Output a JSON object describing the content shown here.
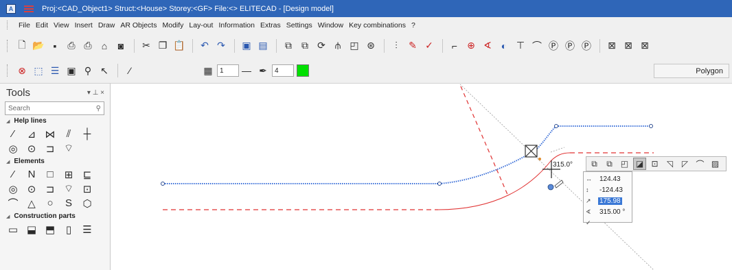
{
  "window": {
    "app_icon": "A",
    "title": "Proj:<CAD_Object1> Struct:<House> Storey:<GF> File:<> ELITECAD - [Design model]"
  },
  "menu": [
    "File",
    "Edit",
    "View",
    "Insert",
    "Draw",
    "AR Objects",
    "Modify",
    "Lay-out",
    "Information",
    "Extras",
    "Settings",
    "Window",
    "Key combinations",
    "?"
  ],
  "toolbar1_icons": [
    "new-file-icon",
    "open-file-icon",
    "save-icon",
    "print-icon",
    "print-preview-icon",
    "plot-icon",
    "export-icon",
    "cut-icon",
    "copy-icon",
    "paste-icon",
    "undo-icon",
    "redo-icon",
    "zoom-window-icon",
    "zoom-all-icon",
    "copy-object-icon",
    "move-object-icon",
    "rotate-icon",
    "mirror-icon",
    "scale-icon",
    "stretch-icon",
    "array-icon",
    "trim-icon",
    "extend-icon",
    "leader-icon",
    "dimension-icon",
    "angle-dim-icon",
    "radius-dim-icon",
    "height-dim-icon",
    "arc-dim-icon",
    "3d-dim-icon",
    "text-dim-icon",
    "x-dim-icon",
    "layer-icon",
    "layer-off-icon",
    "layer-lock-icon"
  ],
  "toolbar2": {
    "pen_number": "1",
    "color_number": "4",
    "active_color": "#00e000",
    "mode_label": "Polygon"
  },
  "tools_panel": {
    "title": "Tools",
    "pin_glyph": "▾  ⊥  ×",
    "search_placeholder": "Search",
    "sections": [
      {
        "label": "Help lines"
      },
      {
        "label": "Elements"
      },
      {
        "label": "Construction parts"
      }
    ]
  },
  "canvas": {
    "angle_label": "315.0°",
    "coords": {
      "dx": "124.43",
      "dy": "-124.43",
      "length": "175.98",
      "angle": "315.00 °"
    }
  }
}
